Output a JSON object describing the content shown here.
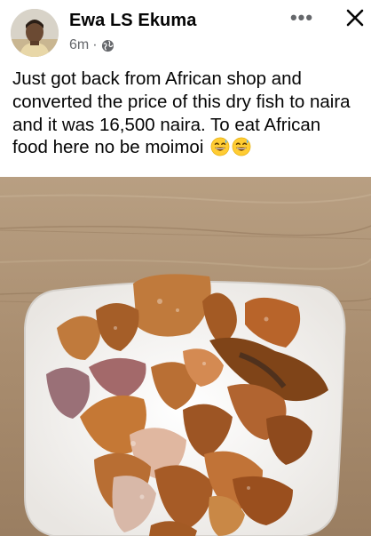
{
  "post": {
    "author_name": "Ewa LS Ekuma",
    "time_ago": "6m",
    "separator": "·",
    "privacy_icon": "globe-icon",
    "text": "Just got back from African shop and converted the price of this dry fish to naira and it was 16,500 naira.   To eat African food here no be moimoi",
    "emoji": [
      "😅",
      "😅"
    ]
  },
  "header_actions": {
    "more_label": "•••",
    "more_icon": "more-icon",
    "close_icon": "close-icon"
  },
  "photo": {
    "subject": "dry-fish-plate"
  },
  "colors": {
    "text": "#050505",
    "secondary": "#65676b",
    "table": "#b59b7c",
    "plate": "#f6f4f1"
  }
}
